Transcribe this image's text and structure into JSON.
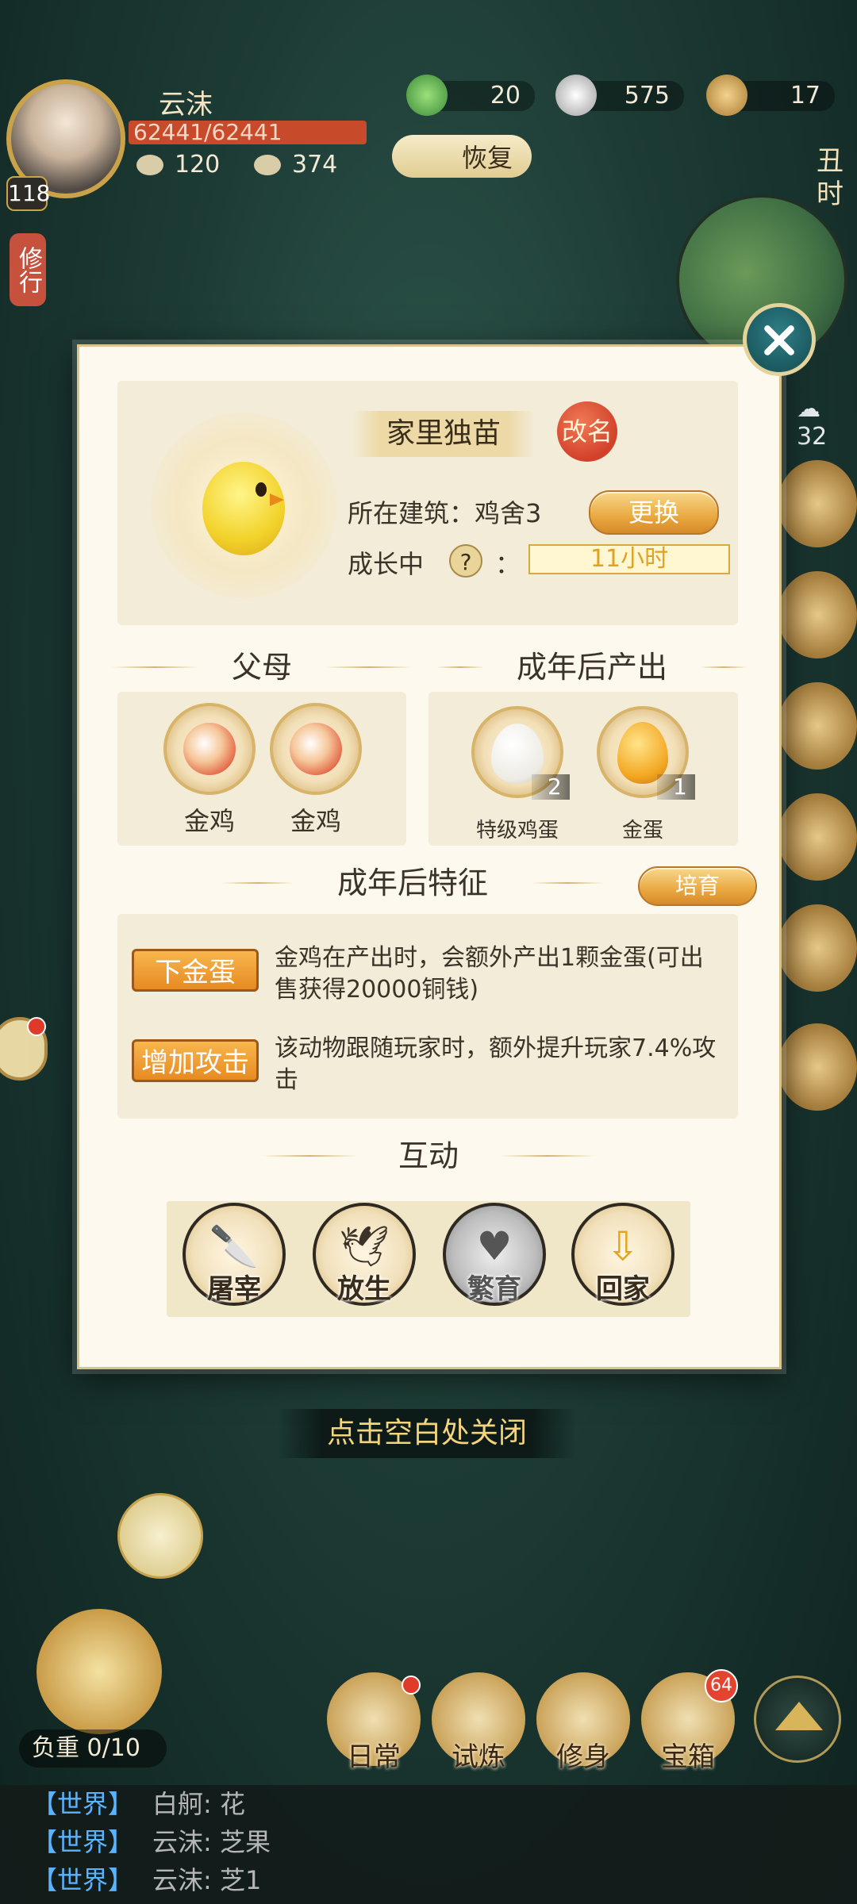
{
  "hud": {
    "player_name": "云沫",
    "level": "118",
    "hp": "62441/62441",
    "stat_a": "120",
    "stat_b": "374",
    "currencies": [
      {
        "icon": "jade-icon",
        "value": "20"
      },
      {
        "icon": "silver-ingot-icon",
        "value": "575"
      },
      {
        "icon": "copper-coin-icon",
        "value": "17"
      }
    ],
    "restore_label": "恢复",
    "time_label": "丑时",
    "cultivate_tag": "修行",
    "weather_value": "32"
  },
  "dialog": {
    "pet_name": "家里独苗",
    "rename_label": "改名",
    "building_label": "所在建筑：鸡舍3",
    "change_label": "更换",
    "growth_label": "成长中",
    "growth_colon": "：",
    "help_icon": "?",
    "timer": "11小时",
    "parents_title": "父母",
    "output_title": "成年后产出",
    "parents": [
      {
        "name": "金鸡",
        "icon": "golden-rooster-icon"
      },
      {
        "name": "金鸡",
        "icon": "golden-rooster-icon"
      }
    ],
    "outputs": [
      {
        "name": "特级鸡蛋",
        "count": "2",
        "icon": "premium-egg-icon"
      },
      {
        "name": "金蛋",
        "count": "1",
        "icon": "golden-egg-icon"
      }
    ],
    "traits_title": "成年后特征",
    "cultivate_label": "培育",
    "traits": [
      {
        "tag": "下金蛋",
        "desc": "金鸡在产出时，会额外产出1颗金蛋(可出售获得20000铜钱)"
      },
      {
        "tag": "增加攻击",
        "desc": "该动物跟随玩家时，额外提升玩家7.4%攻击"
      }
    ],
    "interact_title": "互动",
    "interactions": [
      {
        "label": "屠宰",
        "icon": "cleaver-icon",
        "enabled": true
      },
      {
        "label": "放生",
        "icon": "bird-release-icon",
        "enabled": true
      },
      {
        "label": "繁育",
        "icon": "hearts-icon",
        "enabled": false
      },
      {
        "label": "回家",
        "icon": "home-arrow-icon",
        "enabled": true
      }
    ],
    "close_hint": "点击空白处关闭"
  },
  "bottom": {
    "weight_label": "负重 0/10",
    "nav": [
      {
        "label": "日常"
      },
      {
        "label": "试炼"
      },
      {
        "label": "修身"
      },
      {
        "label": "宝箱",
        "badge": "64"
      }
    ]
  },
  "chat": [
    {
      "channel": "【世界】",
      "msg": "白舸: 花"
    },
    {
      "channel": "【世界】",
      "msg": "云沫: 芝果"
    },
    {
      "channel": "【世界】",
      "msg": "云沫: 芝1"
    }
  ],
  "colors": {
    "accent_gold": "#e9a941",
    "hp_red": "#c74a2a",
    "chat_channel": "#5ab3ff"
  }
}
